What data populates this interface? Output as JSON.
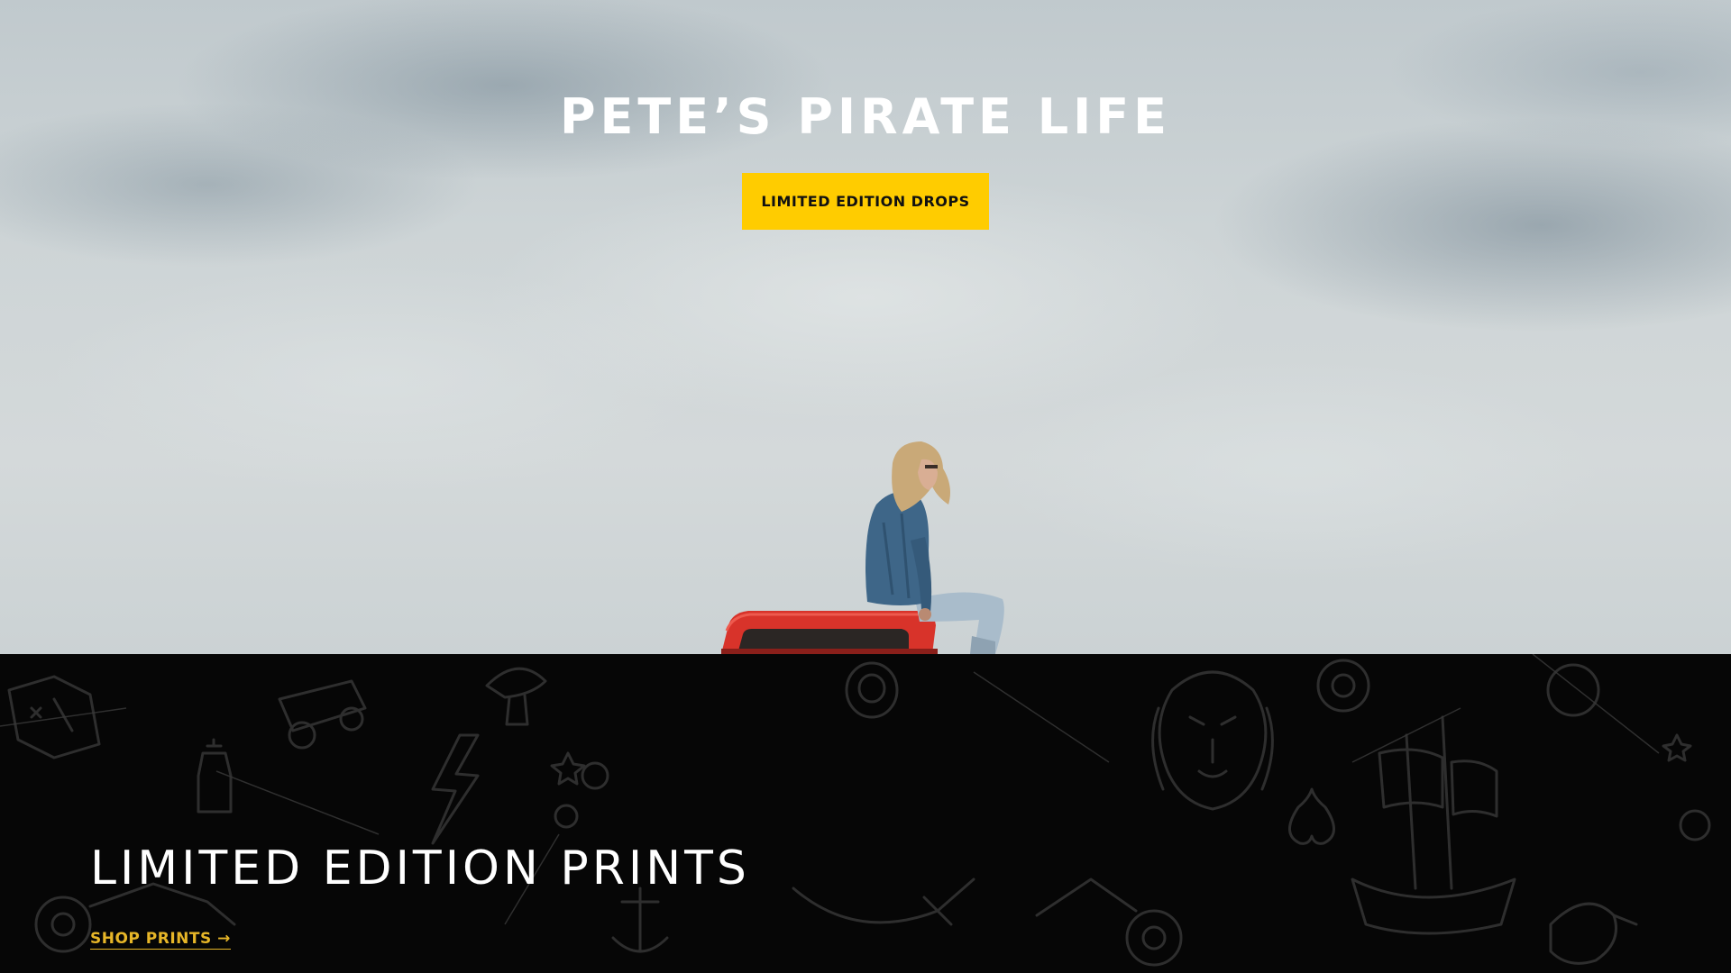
{
  "hero": {
    "title": "PETE’S PIRATE LIFE",
    "cta_label": "LIMITED EDITION DROPS"
  },
  "section": {
    "title": "LIMITED EDITION PRINTS",
    "link_label": "SHOP PRINTS →"
  },
  "colors": {
    "accent": "#ffcc00",
    "link": "#e7b628",
    "dark_band": "#060606",
    "truck": "#d8332a",
    "jacket": "#3e6688",
    "jeans": "#a9bccb"
  },
  "icons": [
    "lion-icon",
    "ship-icon",
    "ring-icon",
    "lantern-icon",
    "lightning-icon",
    "motorcycle-icon",
    "map-icon",
    "cannon-icon",
    "anchor-icon",
    "compass-icon",
    "dagger-icon",
    "ace-of-spades-icon",
    "parrot-icon",
    "coin-icon",
    "mushroom-icon",
    "star-icon"
  ]
}
